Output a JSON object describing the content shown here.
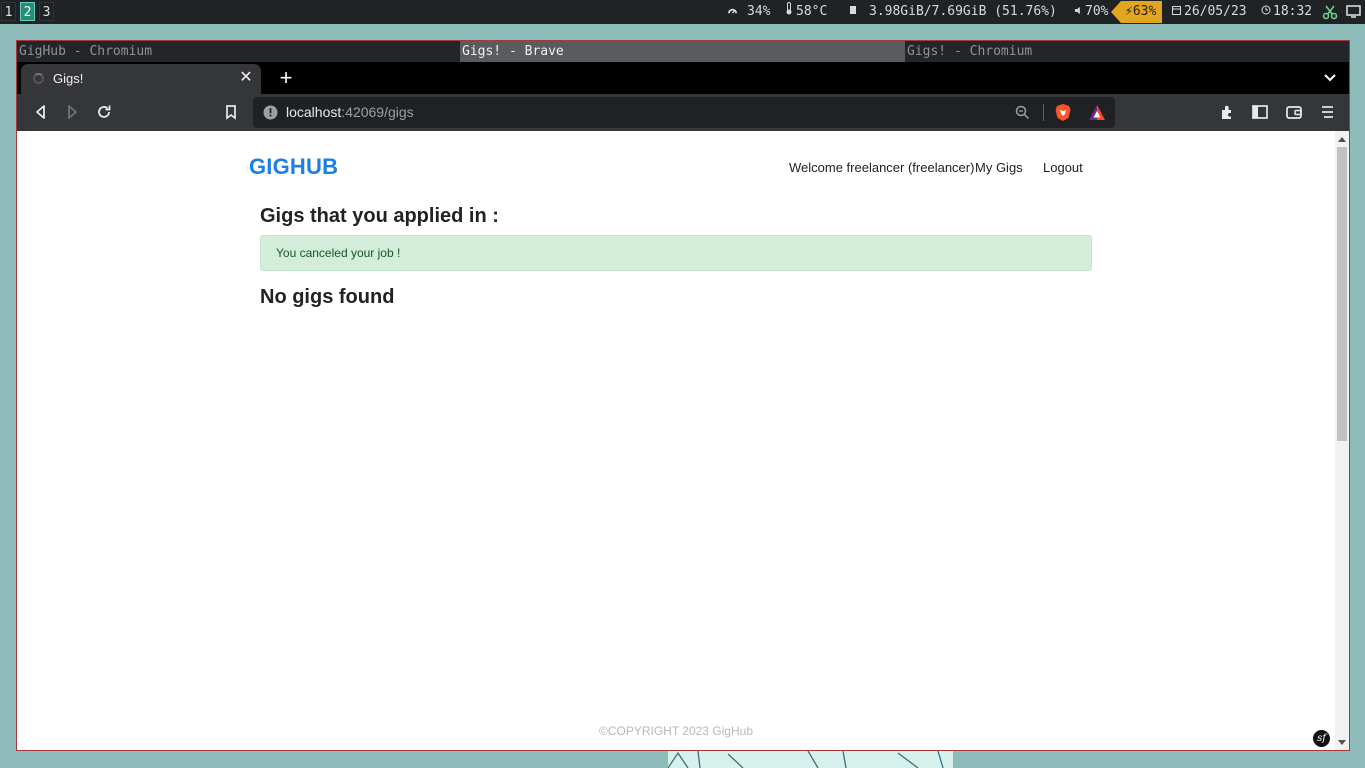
{
  "statusbar": {
    "workspaces": [
      "1",
      "2",
      "3"
    ],
    "active_workspace": "2",
    "cpu": "34%",
    "temp": "58°C",
    "memory": "3.98GiB/7.69GiB (51.76%)",
    "volume": "70%",
    "battery": "63%",
    "date": "26/05/23",
    "time": "18:32",
    "icons": [
      "gauge-icon",
      "thermometer-icon",
      "memory-icon",
      "speaker-icon",
      "battery-charging-icon",
      "calendar-icon",
      "clock-icon",
      "tray-app-icon",
      "tray-window-icon"
    ]
  },
  "wm": {
    "titles": [
      "GigHub - Chromium",
      "Gigs! - Brave",
      "Gigs! - Chromium"
    ],
    "active_index": 1
  },
  "browser": {
    "tab_title": "Gigs!",
    "tab_close": "✕",
    "new_tab": "+",
    "url_host": "localhost",
    "url_rest": ":42069/gigs"
  },
  "page": {
    "brand": "GIGHUB",
    "nav": {
      "welcome": "Welcome freelancer (freelancer)",
      "my_gigs": "My Gigs",
      "logout": "Logout"
    },
    "heading": "Gigs that you applied in :",
    "alert": "You canceled your job !",
    "empty_message": "No gigs found",
    "footer": "©COPYRIGHT 2023 GigHub",
    "debug_badge": "sf"
  },
  "colors": {
    "brand": "#1a7fe6",
    "alert_bg": "#d4edda",
    "alert_text": "#155724",
    "battery_chip": "#e1a61f",
    "active_workspace": "#2e8a78",
    "window_border": "#a93939"
  }
}
